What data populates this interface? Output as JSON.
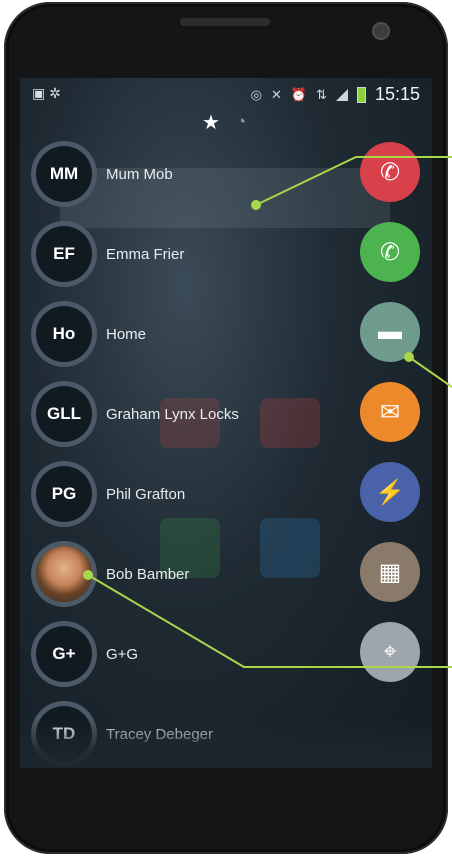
{
  "statusbar": {
    "time": "15:15"
  },
  "tabs": [
    {
      "icon": "star-icon",
      "glyph": "★"
    },
    {
      "icon": "clock-icon",
      "glyph": "◔"
    }
  ],
  "contacts": [
    {
      "initials": "MM",
      "name": "Mum Mob"
    },
    {
      "initials": "EF",
      "name": "Emma Frier"
    },
    {
      "initials": "Ho",
      "name": "Home"
    },
    {
      "initials": "GLL",
      "name": "Graham Lynx Locks"
    },
    {
      "initials": "PG",
      "name": "Phil Grafton"
    },
    {
      "initials": "",
      "name": "Bob Bamber"
    },
    {
      "initials": "G+",
      "name": "G+G"
    },
    {
      "initials": "TD",
      "name": "Tracey Debeger"
    }
  ],
  "actions": [
    {
      "name": "phone-icon",
      "glyph": "✆",
      "color": "#d9414a"
    },
    {
      "name": "whatsapp-icon",
      "glyph": "✆",
      "color": "#4cb34f"
    },
    {
      "name": "message-icon",
      "glyph": "▬",
      "color": "#6f9a8e"
    },
    {
      "name": "email-icon",
      "glyph": "✉",
      "color": "#ec8a2b"
    },
    {
      "name": "messenger-icon",
      "glyph": "⚡",
      "color": "#4a62a8"
    },
    {
      "name": "calendar-icon",
      "glyph": "▦",
      "color": "#8a7a6a"
    },
    {
      "name": "map-icon",
      "glyph": "⌖",
      "color": "#9fa6ab"
    }
  ],
  "callout_color": "#a8d84a"
}
